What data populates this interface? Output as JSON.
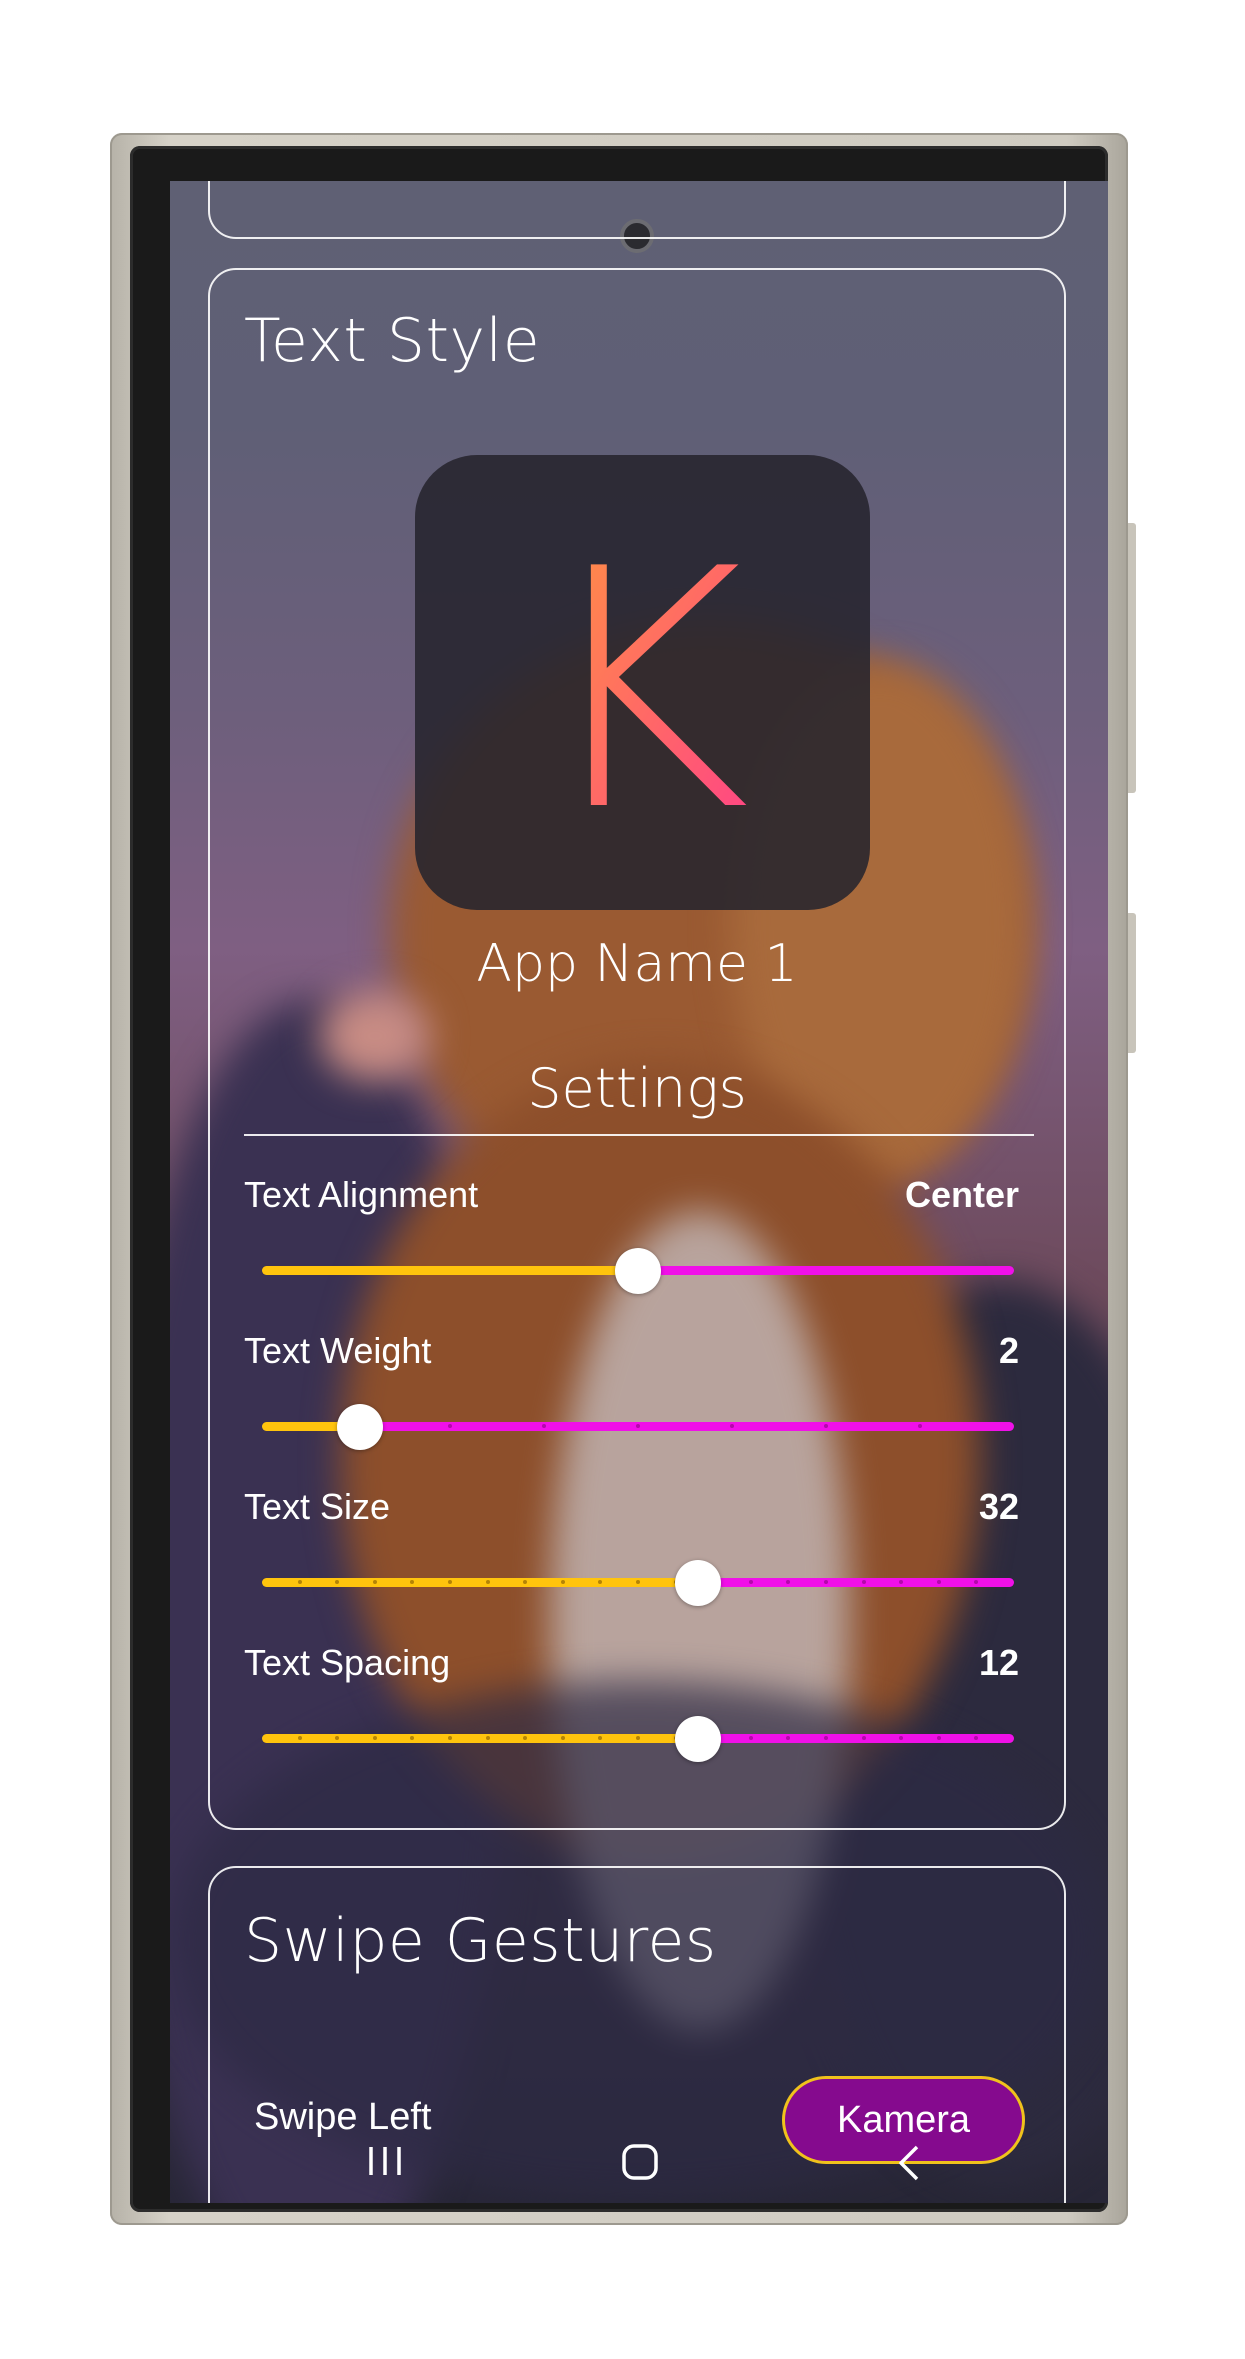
{
  "text_style_card": {
    "title": "Text Style",
    "preview_letter": "K",
    "app_name": "App Name 1",
    "settings_label": "Settings"
  },
  "settings": [
    {
      "label": "Text Alignment",
      "value": "Center",
      "position": 0.5,
      "ticks": 0
    },
    {
      "label": "Text Weight",
      "value": "2",
      "position": 0.13,
      "ticks": 8
    },
    {
      "label": "Text Size",
      "value": "32",
      "position": 0.58,
      "ticks": 20
    },
    {
      "label": "Text Spacing",
      "value": "12",
      "position": 0.58,
      "ticks": 20
    }
  ],
  "swipe_card": {
    "title": "Swipe Gestures",
    "swipe_left_label": "Swipe Left",
    "kamera_button": "Kamera"
  },
  "colors": {
    "slider_active": "#ffc40d",
    "slider_inactive": "#f010e8",
    "kamera_button_bg": "#850a8e",
    "kamera_button_border": "#f0c21c",
    "letter_gradient_start": "#ff9a3c",
    "letter_gradient_end": "#ff3f8a"
  },
  "nav_bar": {
    "icons": [
      "recent-apps-icon",
      "home-icon",
      "back-icon"
    ]
  }
}
